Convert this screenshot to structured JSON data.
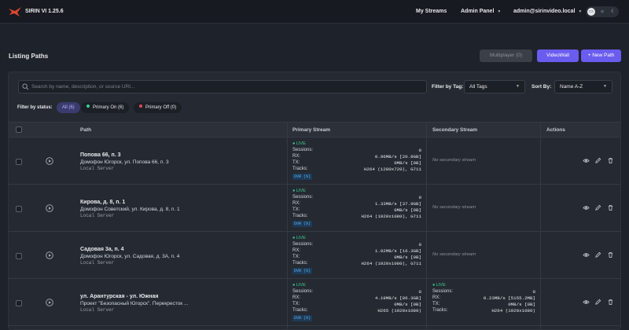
{
  "app": {
    "name": "SIRIN VI 1.25.6"
  },
  "nav": {
    "streams": "My Streams",
    "admin": "Admin Panel",
    "user": "admin@sirinvideo.local"
  },
  "page": {
    "title": "Listing Paths"
  },
  "buttons": {
    "multiplayer": "Multiplayer (0)",
    "videowall": "VideoWall",
    "new_path": "+ New Path"
  },
  "search": {
    "placeholder": "Search by name, description, or source URI..."
  },
  "filters": {
    "tag_label": "Filter by Tag:",
    "tag_value": "All Tags",
    "sort_label": "Sort By:",
    "sort_value": "Name A-Z",
    "status_label": "Filter by status:",
    "status_chips": [
      "All (6)",
      "Primary On (6)",
      "Primary Off (0)"
    ]
  },
  "table": {
    "headers": {
      "path": "Path",
      "primary": "Primary Stream",
      "secondary": "Secondary Stream",
      "actions": "Actions"
    },
    "stat_labels": {
      "sessions": "Sessions:",
      "rx": "RX:",
      "tx": "TX:",
      "tracks": "Tracks:"
    },
    "live_label": "● LIVE",
    "badge": "DVR (%)",
    "no_secondary": "No secondary stream",
    "rows": [
      {
        "name": "Попова 66, п. 3",
        "desc": "Домофон Югорск, ул. Попова 66, п. 3",
        "server": "Local Server",
        "primary": {
          "sessions": "0",
          "rx": "0.96MB/s [20.8GB]",
          "tx": "0MB/s [0B]",
          "tracks": "H264 (1280x720), G711"
        },
        "secondary": null
      },
      {
        "name": "Кирова, д. 8, п. 1",
        "desc": "Домофон Советский, ул. Кирова, д. 8, п. 1",
        "server": "Local Server",
        "primary": {
          "sessions": "0",
          "rx": "1.33MB/s [37.9GB]",
          "tx": "0MB/s [0B]",
          "tracks": "H264 (1920x1080), G711"
        },
        "secondary": null
      },
      {
        "name": "Садовая 3а, п. 4",
        "desc": "Домофон Югорск, ул. Садовая, д. 3А, п. 4",
        "server": "Local Server",
        "primary": {
          "sessions": "0",
          "rx": "1.02MB/s [16.3GB]",
          "tx": "0MB/s [0B]",
          "tracks": "H264 (1920x1080), G711"
        },
        "secondary": null
      },
      {
        "name": "ул. Арантурская - ул. Южная",
        "desc": "Проект \"Безопасный Югорск\". Перекресток ...",
        "server": "Local Server",
        "primary": {
          "sessions": "0",
          "rx": "4.19MB/s [86.3GB]",
          "tx": "0MB/s [0B]",
          "tracks": "H265 (1920x1080)"
        },
        "secondary": {
          "sessions": "0",
          "rx": "0.23MB/s [5155.2MB]",
          "tx": "0MB/s [0B]",
          "tracks": "H264 (1920x1080)"
        }
      }
    ]
  },
  "colors": {
    "accent": "#6b5cf0",
    "live": "#3ecf8e",
    "status_on": "#3ecf8e",
    "status_off": "#e5484d"
  },
  "icons": {
    "logo": "bird-logo-icon",
    "search": "search-icon",
    "play": "play-circle-icon",
    "view": "eye-icon",
    "edit": "pencil-icon",
    "delete": "trash-icon"
  }
}
